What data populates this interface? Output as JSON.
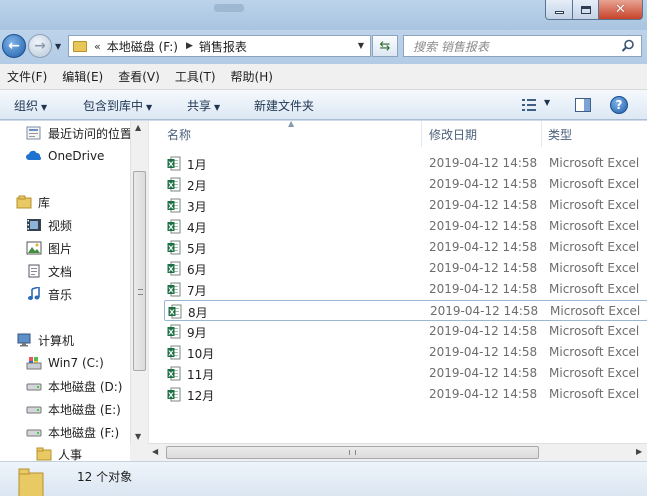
{
  "window": {
    "buttons": {
      "minimize": "minimize",
      "maximize": "maximize",
      "close": "✕"
    }
  },
  "nav": {
    "address": {
      "prefix": "«",
      "segment1": "本地磁盘 (F:)",
      "segment2": "销售报表"
    },
    "search_placeholder": "搜索 销售报表"
  },
  "menu": [
    "文件(F)",
    "编辑(E)",
    "查看(V)",
    "工具(T)",
    "帮助(H)"
  ],
  "toolbar": {
    "organize": "组织",
    "include_in_library": "包含到库中",
    "share": "共享",
    "new_folder": "新建文件夹"
  },
  "sidebar": {
    "items": [
      {
        "label": "最近访问的位置",
        "icon": "recent-places-icon"
      },
      {
        "label": "OneDrive",
        "icon": "onedrive-cloud-icon"
      },
      {
        "label": "库",
        "icon": "library-icon"
      },
      {
        "label": "视频",
        "icon": "videos-icon"
      },
      {
        "label": "图片",
        "icon": "pictures-icon"
      },
      {
        "label": "文档",
        "icon": "documents-icon"
      },
      {
        "label": "音乐",
        "icon": "music-icon"
      },
      {
        "label": "计算机",
        "icon": "computer-icon"
      },
      {
        "label": "Win7 (C:)",
        "icon": "system-drive-icon"
      },
      {
        "label": "本地磁盘 (D:)",
        "icon": "drive-icon"
      },
      {
        "label": "本地磁盘 (E:)",
        "icon": "drive-icon"
      },
      {
        "label": "本地磁盘 (F:)",
        "icon": "drive-icon"
      },
      {
        "label": "人事",
        "icon": "folder-icon"
      }
    ]
  },
  "columns": {
    "name": "名称",
    "date": "修改日期",
    "type": "类型"
  },
  "files": [
    {
      "name": "1月",
      "date": "2019-04-12 14:58",
      "type": "Microsoft Excel"
    },
    {
      "name": "2月",
      "date": "2019-04-12 14:58",
      "type": "Microsoft Excel"
    },
    {
      "name": "3月",
      "date": "2019-04-12 14:58",
      "type": "Microsoft Excel"
    },
    {
      "name": "4月",
      "date": "2019-04-12 14:58",
      "type": "Microsoft Excel"
    },
    {
      "name": "5月",
      "date": "2019-04-12 14:58",
      "type": "Microsoft Excel"
    },
    {
      "name": "6月",
      "date": "2019-04-12 14:58",
      "type": "Microsoft Excel"
    },
    {
      "name": "7月",
      "date": "2019-04-12 14:58",
      "type": "Microsoft Excel"
    },
    {
      "name": "8月",
      "date": "2019-04-12 14:58",
      "type": "Microsoft Excel"
    },
    {
      "name": "9月",
      "date": "2019-04-12 14:58",
      "type": "Microsoft Excel"
    },
    {
      "name": "10月",
      "date": "2019-04-12 14:58",
      "type": "Microsoft Excel"
    },
    {
      "name": "11月",
      "date": "2019-04-12 14:58",
      "type": "Microsoft Excel"
    },
    {
      "name": "12月",
      "date": "2019-04-12 14:58",
      "type": "Microsoft Excel"
    }
  ],
  "selected_file": "8月",
  "status": {
    "count_text": "12 个对象"
  },
  "colors": {
    "excel_green": "#1d7044",
    "title_bar": "#b3cbe5",
    "close_red": "#c7432a"
  }
}
